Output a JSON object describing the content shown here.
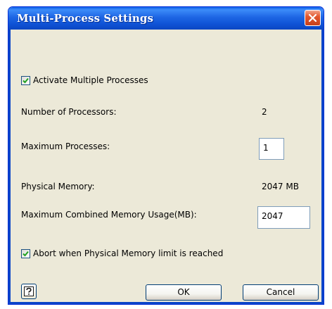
{
  "window": {
    "title": "Multi-Process Settings"
  },
  "options": {
    "activate_multiple_processes": {
      "label": "Activate Multiple Processes",
      "checked": true
    },
    "number_of_processors": {
      "label": "Number of Processors:",
      "value": "2"
    },
    "maximum_processes": {
      "label": "Maximum Processes:",
      "value": "1"
    },
    "physical_memory": {
      "label": "Physical Memory:",
      "value": "2047 MB"
    },
    "maximum_combined_memory": {
      "label": "Maximum Combined Memory Usage(MB):",
      "value": "2047"
    },
    "abort_on_memory_limit": {
      "label": "Abort when Physical Memory limit is reached",
      "checked": true
    }
  },
  "buttons": {
    "ok": "OK",
    "cancel": "Cancel"
  },
  "icons": {
    "close": "close-icon",
    "help": "help-icon",
    "checkmark": "checkmark-icon"
  },
  "colors": {
    "titlebar": "#0F53D6",
    "dialog_background": "#ECE9D8",
    "close_button": "#E2582F",
    "checkmark": "#21A121"
  }
}
